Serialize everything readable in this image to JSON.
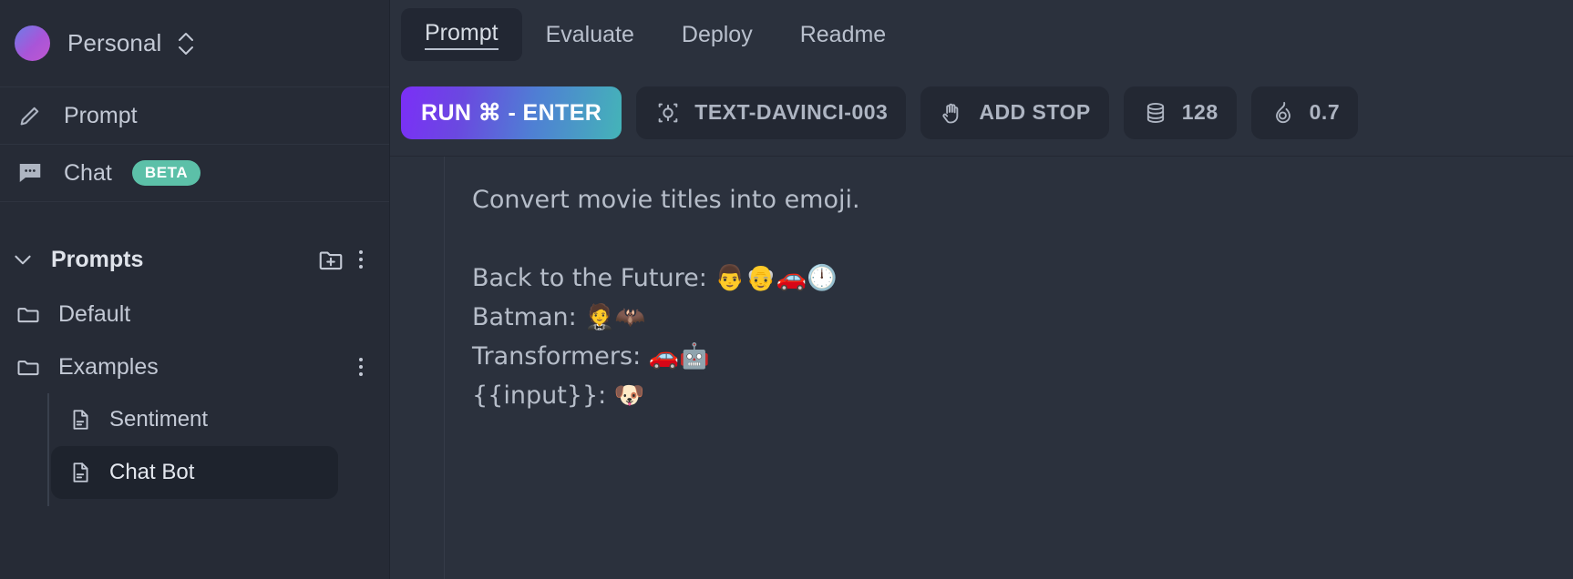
{
  "sidebar": {
    "workspace": {
      "name": "Personal",
      "avatar_colors": [
        "#6d7de8",
        "#c058d0"
      ],
      "switch_icon": "chevron-up-down-icon"
    },
    "nav": [
      {
        "label": "Prompt",
        "icon": "pencil-icon",
        "badge": null
      },
      {
        "label": "Chat",
        "icon": "chat-bubble-icon",
        "badge": "BETA"
      }
    ],
    "section": {
      "title": "Prompts",
      "collapse_icon": "chevron-down-icon",
      "new_folder_icon": "folder-plus-icon",
      "more_icon": "kebab-menu-icon"
    },
    "tree": [
      {
        "type": "folder",
        "label": "Default",
        "icon": "folder-icon",
        "has_menu": false,
        "children": []
      },
      {
        "type": "folder",
        "label": "Examples",
        "icon": "folder-icon",
        "has_menu": true,
        "children": [
          {
            "type": "file",
            "label": "Sentiment",
            "icon": "document-icon",
            "selected": false
          },
          {
            "type": "file",
            "label": "Chat Bot",
            "icon": "document-icon",
            "selected": true
          }
        ]
      }
    ]
  },
  "main": {
    "tabs": [
      {
        "label": "Prompt",
        "active": true
      },
      {
        "label": "Evaluate",
        "active": false
      },
      {
        "label": "Deploy",
        "active": false
      },
      {
        "label": "Readme",
        "active": false
      }
    ],
    "toolbar": {
      "run_label": "RUN ⌘ - ENTER",
      "model": {
        "label": "TEXT-DAVINCI-003",
        "icon": "model-node-icon"
      },
      "add_stop": {
        "label": "ADD STOP",
        "icon": "hand-stop-icon"
      },
      "max_tokens": {
        "value": "128",
        "icon": "database-stack-icon"
      },
      "temperature": {
        "value": "0.7",
        "icon": "flame-icon"
      }
    },
    "editor": {
      "content": "Convert movie titles into emoji.\n\nBack to the Future: 👨👴🚗🕛\nBatman: 🤵🦇\nTransformers: 🚗🤖\n{{input}}: 🐶"
    }
  },
  "colors": {
    "sidebar_bg": "#262b36",
    "main_bg": "#2b313d",
    "accent_beta": "#5cc0a8",
    "run_gradient_start": "#7b2ff7",
    "run_gradient_end": "#44b4b8",
    "text_primary": "#c3c9d5"
  }
}
